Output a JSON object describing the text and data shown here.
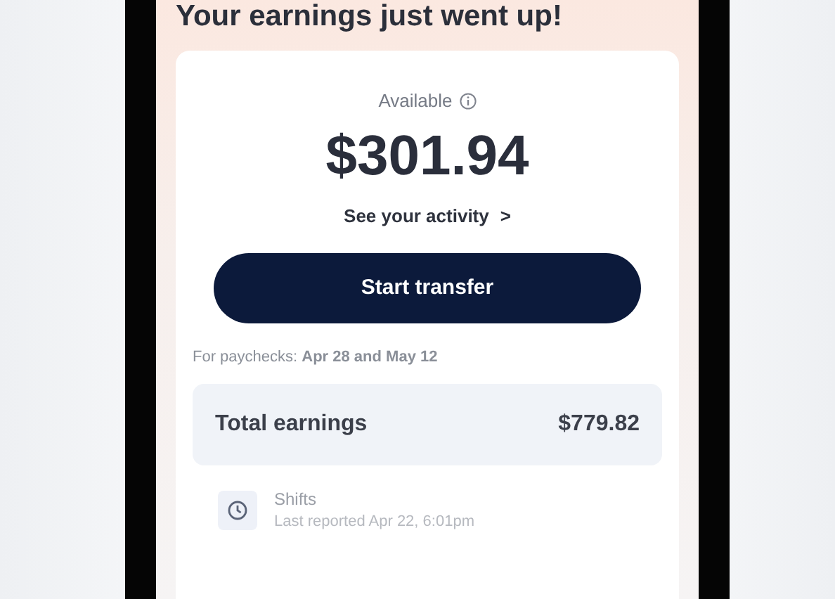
{
  "heading": "Your earnings just went up!",
  "balance": {
    "label": "Available",
    "amount": "$301.94"
  },
  "activity_link": {
    "label": "See your activity",
    "chevron": ">"
  },
  "button": "Start transfer",
  "paychecks": "For paychecks: **Apr 28 and May 12**",
  "total": {
    "label": "Total earnings",
    "value": "$779.82"
  },
  "shifts": {
    "title": "Shifts",
    "subtitle": "Last reported Apr 22, 6:01pm"
  }
}
